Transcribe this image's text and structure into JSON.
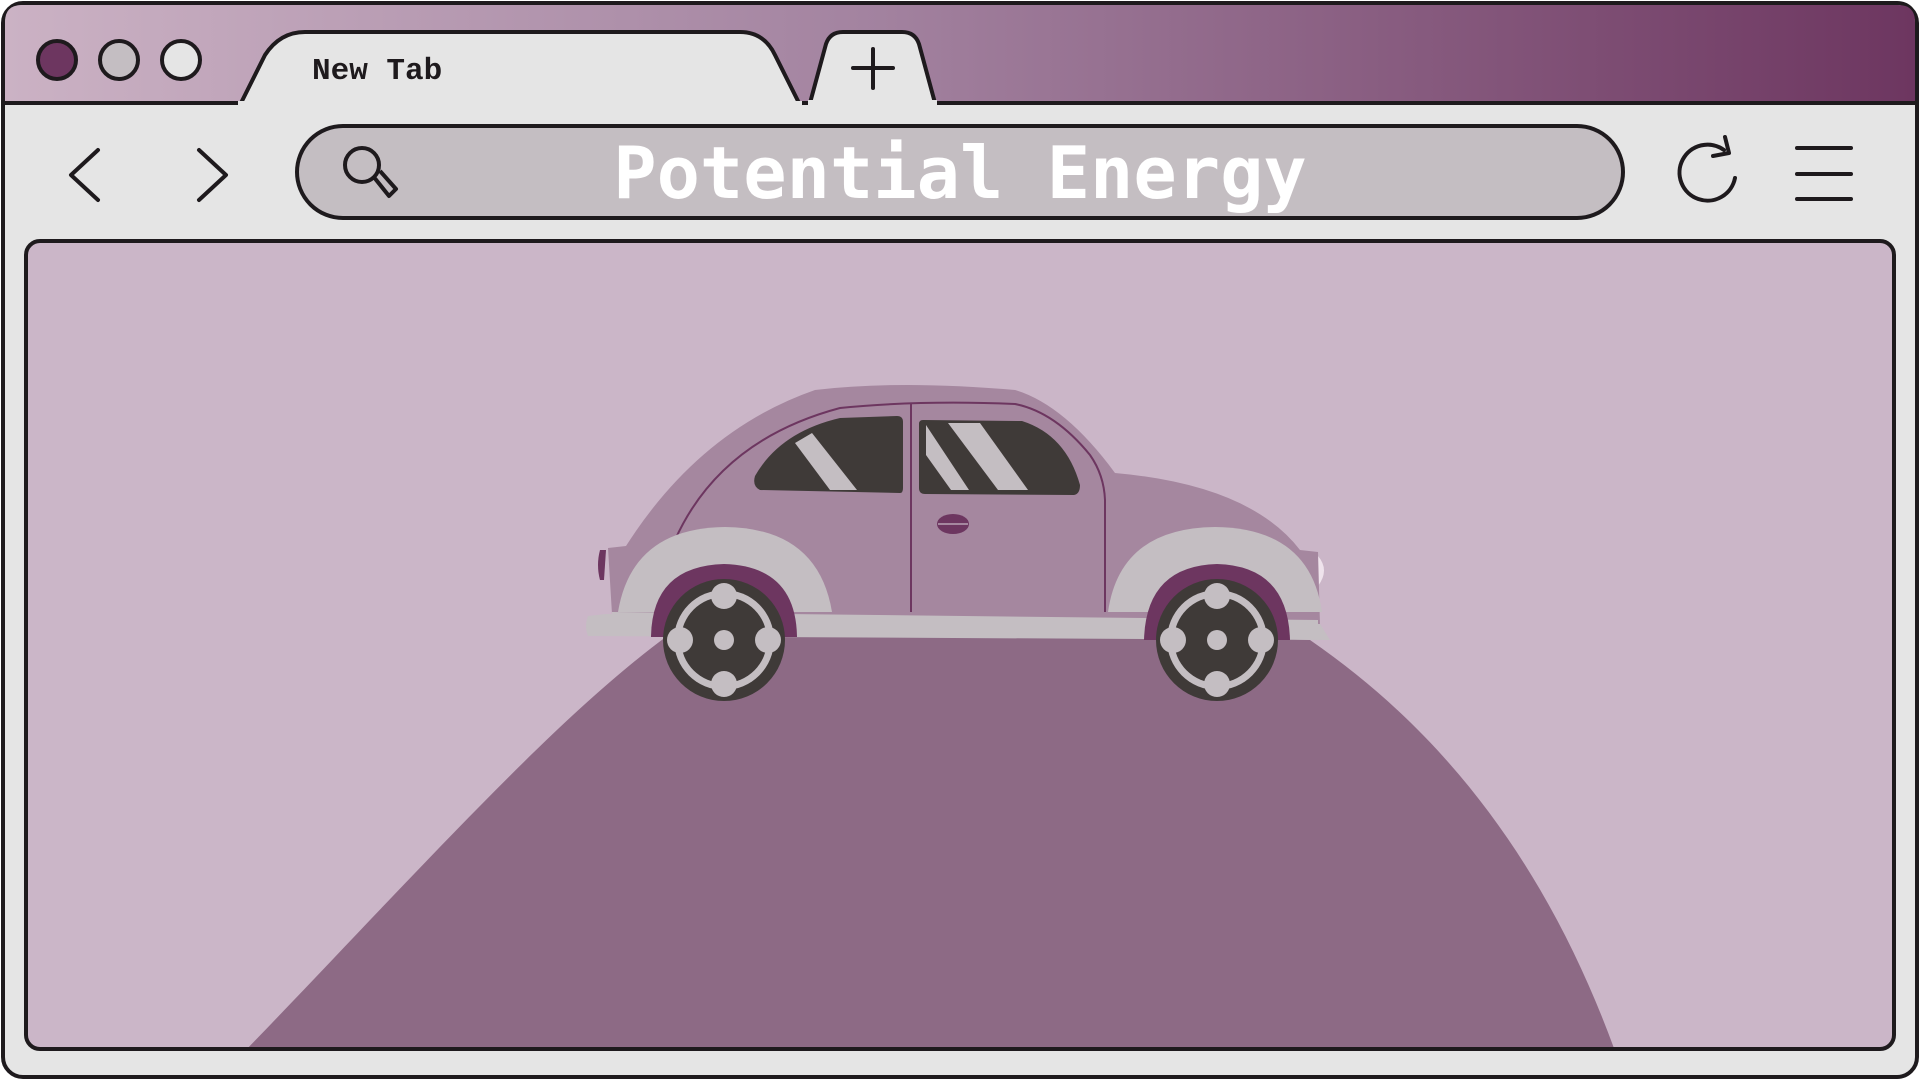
{
  "window": {
    "controls": [
      "close",
      "minimize",
      "maximize"
    ]
  },
  "tabs": [
    {
      "label": "New Tab",
      "active": true
    }
  ],
  "new_tab_label": "+",
  "toolbar": {
    "back_icon": "chevron-left-icon",
    "forward_icon": "chevron-right-icon",
    "search_icon": "magnifier-icon",
    "address_text": "Potential Energy",
    "reload_icon": "reload-icon",
    "menu_icon": "hamburger-menu-icon"
  },
  "content": {
    "scene": "car-on-hill-illustration"
  },
  "colors": {
    "accent_dark": "#6d3660",
    "titlebar_light": "#cbb2c4",
    "chrome_gray": "#e5e5e5",
    "address_bar": "#c4bec2",
    "viewport_bg": "#cbb6c8",
    "hill": "#8d6a85",
    "car_body": "#a5879f",
    "car_trim": "#c4bec2",
    "tire": "#3f3a38",
    "outline": "#1e1a1d"
  }
}
